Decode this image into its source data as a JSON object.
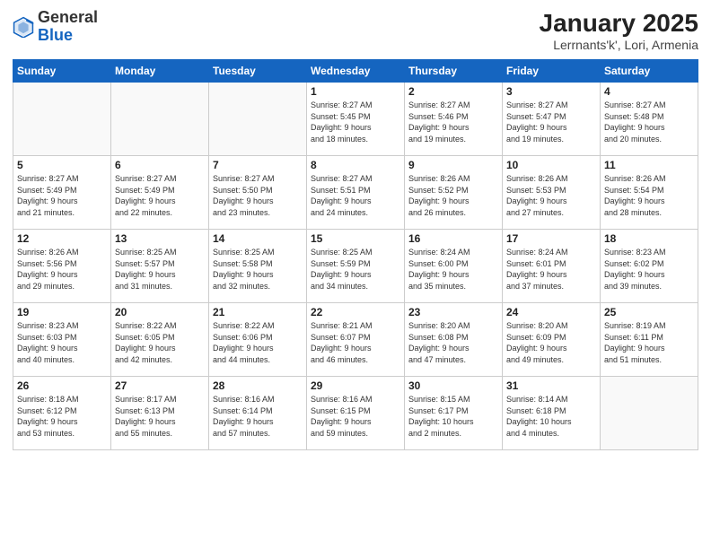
{
  "logo": {
    "general": "General",
    "blue": "Blue"
  },
  "header": {
    "title": "January 2025",
    "subtitle": "Lerrnants'k', Lori, Armenia"
  },
  "days_of_week": [
    "Sunday",
    "Monday",
    "Tuesday",
    "Wednesday",
    "Thursday",
    "Friday",
    "Saturday"
  ],
  "weeks": [
    [
      {
        "day": "",
        "info": ""
      },
      {
        "day": "",
        "info": ""
      },
      {
        "day": "",
        "info": ""
      },
      {
        "day": "1",
        "info": "Sunrise: 8:27 AM\nSunset: 5:45 PM\nDaylight: 9 hours\nand 18 minutes."
      },
      {
        "day": "2",
        "info": "Sunrise: 8:27 AM\nSunset: 5:46 PM\nDaylight: 9 hours\nand 19 minutes."
      },
      {
        "day": "3",
        "info": "Sunrise: 8:27 AM\nSunset: 5:47 PM\nDaylight: 9 hours\nand 19 minutes."
      },
      {
        "day": "4",
        "info": "Sunrise: 8:27 AM\nSunset: 5:48 PM\nDaylight: 9 hours\nand 20 minutes."
      }
    ],
    [
      {
        "day": "5",
        "info": "Sunrise: 8:27 AM\nSunset: 5:49 PM\nDaylight: 9 hours\nand 21 minutes."
      },
      {
        "day": "6",
        "info": "Sunrise: 8:27 AM\nSunset: 5:49 PM\nDaylight: 9 hours\nand 22 minutes."
      },
      {
        "day": "7",
        "info": "Sunrise: 8:27 AM\nSunset: 5:50 PM\nDaylight: 9 hours\nand 23 minutes."
      },
      {
        "day": "8",
        "info": "Sunrise: 8:27 AM\nSunset: 5:51 PM\nDaylight: 9 hours\nand 24 minutes."
      },
      {
        "day": "9",
        "info": "Sunrise: 8:26 AM\nSunset: 5:52 PM\nDaylight: 9 hours\nand 26 minutes."
      },
      {
        "day": "10",
        "info": "Sunrise: 8:26 AM\nSunset: 5:53 PM\nDaylight: 9 hours\nand 27 minutes."
      },
      {
        "day": "11",
        "info": "Sunrise: 8:26 AM\nSunset: 5:54 PM\nDaylight: 9 hours\nand 28 minutes."
      }
    ],
    [
      {
        "day": "12",
        "info": "Sunrise: 8:26 AM\nSunset: 5:56 PM\nDaylight: 9 hours\nand 29 minutes."
      },
      {
        "day": "13",
        "info": "Sunrise: 8:25 AM\nSunset: 5:57 PM\nDaylight: 9 hours\nand 31 minutes."
      },
      {
        "day": "14",
        "info": "Sunrise: 8:25 AM\nSunset: 5:58 PM\nDaylight: 9 hours\nand 32 minutes."
      },
      {
        "day": "15",
        "info": "Sunrise: 8:25 AM\nSunset: 5:59 PM\nDaylight: 9 hours\nand 34 minutes."
      },
      {
        "day": "16",
        "info": "Sunrise: 8:24 AM\nSunset: 6:00 PM\nDaylight: 9 hours\nand 35 minutes."
      },
      {
        "day": "17",
        "info": "Sunrise: 8:24 AM\nSunset: 6:01 PM\nDaylight: 9 hours\nand 37 minutes."
      },
      {
        "day": "18",
        "info": "Sunrise: 8:23 AM\nSunset: 6:02 PM\nDaylight: 9 hours\nand 39 minutes."
      }
    ],
    [
      {
        "day": "19",
        "info": "Sunrise: 8:23 AM\nSunset: 6:03 PM\nDaylight: 9 hours\nand 40 minutes."
      },
      {
        "day": "20",
        "info": "Sunrise: 8:22 AM\nSunset: 6:05 PM\nDaylight: 9 hours\nand 42 minutes."
      },
      {
        "day": "21",
        "info": "Sunrise: 8:22 AM\nSunset: 6:06 PM\nDaylight: 9 hours\nand 44 minutes."
      },
      {
        "day": "22",
        "info": "Sunrise: 8:21 AM\nSunset: 6:07 PM\nDaylight: 9 hours\nand 46 minutes."
      },
      {
        "day": "23",
        "info": "Sunrise: 8:20 AM\nSunset: 6:08 PM\nDaylight: 9 hours\nand 47 minutes."
      },
      {
        "day": "24",
        "info": "Sunrise: 8:20 AM\nSunset: 6:09 PM\nDaylight: 9 hours\nand 49 minutes."
      },
      {
        "day": "25",
        "info": "Sunrise: 8:19 AM\nSunset: 6:11 PM\nDaylight: 9 hours\nand 51 minutes."
      }
    ],
    [
      {
        "day": "26",
        "info": "Sunrise: 8:18 AM\nSunset: 6:12 PM\nDaylight: 9 hours\nand 53 minutes."
      },
      {
        "day": "27",
        "info": "Sunrise: 8:17 AM\nSunset: 6:13 PM\nDaylight: 9 hours\nand 55 minutes."
      },
      {
        "day": "28",
        "info": "Sunrise: 8:16 AM\nSunset: 6:14 PM\nDaylight: 9 hours\nand 57 minutes."
      },
      {
        "day": "29",
        "info": "Sunrise: 8:16 AM\nSunset: 6:15 PM\nDaylight: 9 hours\nand 59 minutes."
      },
      {
        "day": "30",
        "info": "Sunrise: 8:15 AM\nSunset: 6:17 PM\nDaylight: 10 hours\nand 2 minutes."
      },
      {
        "day": "31",
        "info": "Sunrise: 8:14 AM\nSunset: 6:18 PM\nDaylight: 10 hours\nand 4 minutes."
      },
      {
        "day": "",
        "info": ""
      }
    ]
  ]
}
